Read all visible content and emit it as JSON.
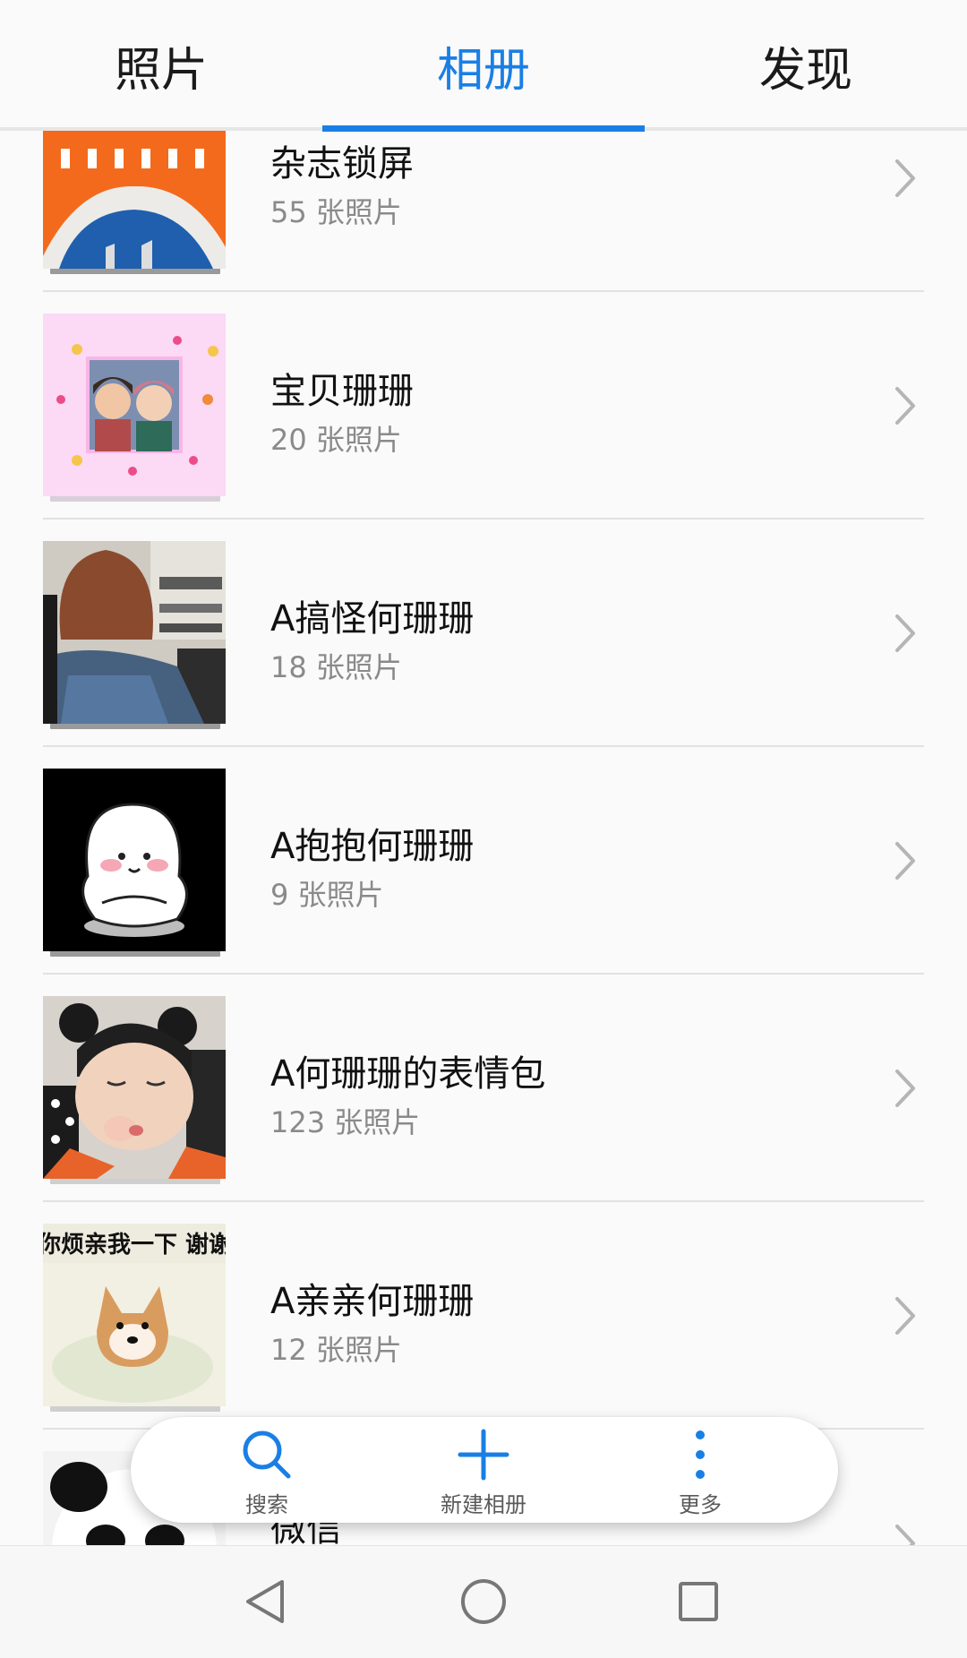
{
  "tabs": [
    {
      "label": "照片",
      "active": false
    },
    {
      "label": "相册",
      "active": true
    },
    {
      "label": "发现",
      "active": false
    }
  ],
  "accent_color": "#1a7fe5",
  "albums": [
    {
      "title": "杂志锁屏",
      "count": "55 张照片",
      "thumb_icon": "architecture-thumbnail"
    },
    {
      "title": "宝贝珊珊",
      "count": "20 张照片",
      "thumb_icon": "selfie-pink-frame-thumbnail"
    },
    {
      "title": "A搞怪何珊珊",
      "count": "18 张照片",
      "thumb_icon": "person-back-thumbnail"
    },
    {
      "title": "A抱抱何珊珊",
      "count": "9 张照片",
      "thumb_icon": "cartoon-hug-thumbnail"
    },
    {
      "title": "A何珊珊的表情包",
      "count": "123 张照片",
      "thumb_icon": "child-face-thumbnail"
    },
    {
      "title": "A亲亲何珊珊",
      "count": "12 张照片",
      "thumb_icon": "dog-meme-thumbnail"
    },
    {
      "title": "微信",
      "count": "",
      "thumb_icon": "panda-meme-thumbnail"
    }
  ],
  "meme_caption": "你烦亲我一下 谢谢",
  "actions": [
    {
      "label": "搜索",
      "icon": "search-icon"
    },
    {
      "label": "新建相册",
      "icon": "plus-icon"
    },
    {
      "label": "更多",
      "icon": "more-vertical-icon"
    }
  ],
  "navigation": [
    "back-icon",
    "home-icon",
    "recent-apps-icon"
  ]
}
